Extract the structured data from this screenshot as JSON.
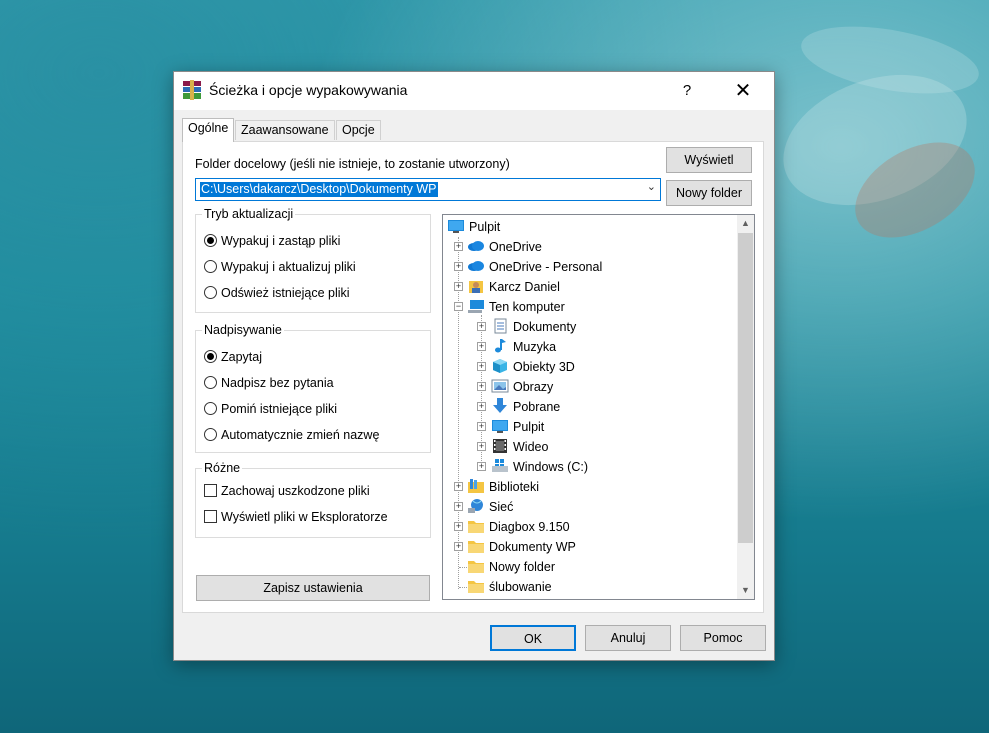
{
  "window": {
    "title": "Ścieżka i opcje wypakowywania",
    "help_label": "?",
    "close_label": "✕"
  },
  "tabs": [
    {
      "label": "Ogólne",
      "active": true
    },
    {
      "label": "Zaawansowane",
      "active": false
    },
    {
      "label": "Opcje",
      "active": false
    }
  ],
  "destination": {
    "label": "Folder docelowy (jeśli nie istnieje, to zostanie utworzony)",
    "value": "C:\\Users\\dakarcz\\Desktop\\Dokumenty WP",
    "view_button": "Wyświetl",
    "new_folder_button": "Nowy folder"
  },
  "update_mode": {
    "title": "Tryb aktualizacji",
    "options": [
      {
        "label": "Wypakuj i zastąp pliki",
        "selected": true
      },
      {
        "label": "Wypakuj i aktualizuj pliki",
        "selected": false
      },
      {
        "label": "Odśwież istniejące pliki",
        "selected": false
      }
    ]
  },
  "overwrite": {
    "title": "Nadpisywanie",
    "options": [
      {
        "label": "Zapytaj",
        "selected": true
      },
      {
        "label": "Nadpisz bez pytania",
        "selected": false
      },
      {
        "label": "Pomiń istniejące pliki",
        "selected": false
      },
      {
        "label": "Automatycznie zmień nazwę",
        "selected": false
      }
    ]
  },
  "misc": {
    "title": "Różne",
    "options": [
      {
        "label": "Zachowaj uszkodzone pliki",
        "checked": false
      },
      {
        "label": "Wyświetl pliki w Eksploratorze",
        "checked": false
      }
    ]
  },
  "save_button": "Zapisz ustawienia",
  "tree": [
    {
      "label": "Pulpit",
      "icon": "desktop-icon"
    },
    {
      "label": "OneDrive",
      "icon": "cloud-icon"
    },
    {
      "label": "OneDrive - Personal",
      "icon": "cloud-icon"
    },
    {
      "label": "Karcz Daniel",
      "icon": "user-folder-icon"
    },
    {
      "label": "Ten komputer",
      "icon": "computer-icon"
    },
    {
      "label": "Dokumenty",
      "icon": "documents-icon"
    },
    {
      "label": "Muzyka",
      "icon": "music-icon"
    },
    {
      "label": "Obiekty 3D",
      "icon": "cube-icon"
    },
    {
      "label": "Obrazy",
      "icon": "pictures-icon"
    },
    {
      "label": "Pobrane",
      "icon": "download-icon"
    },
    {
      "label": "Pulpit",
      "icon": "desktop-icon"
    },
    {
      "label": "Wideo",
      "icon": "video-icon"
    },
    {
      "label": "Windows (C:)",
      "icon": "drive-icon"
    },
    {
      "label": "Biblioteki",
      "icon": "libraries-icon"
    },
    {
      "label": "Sieć",
      "icon": "network-icon"
    },
    {
      "label": "Diagbox 9.150",
      "icon": "folder-icon"
    },
    {
      "label": "Dokumenty WP",
      "icon": "folder-icon"
    },
    {
      "label": "Nowy folder",
      "icon": "folder-icon"
    },
    {
      "label": "ślubowanie",
      "icon": "folder-icon"
    }
  ],
  "footer": {
    "ok": "OK",
    "cancel": "Anuluj",
    "help": "Pomoc"
  },
  "colors": {
    "accent": "#0078d7",
    "folder": "#f4c542"
  }
}
